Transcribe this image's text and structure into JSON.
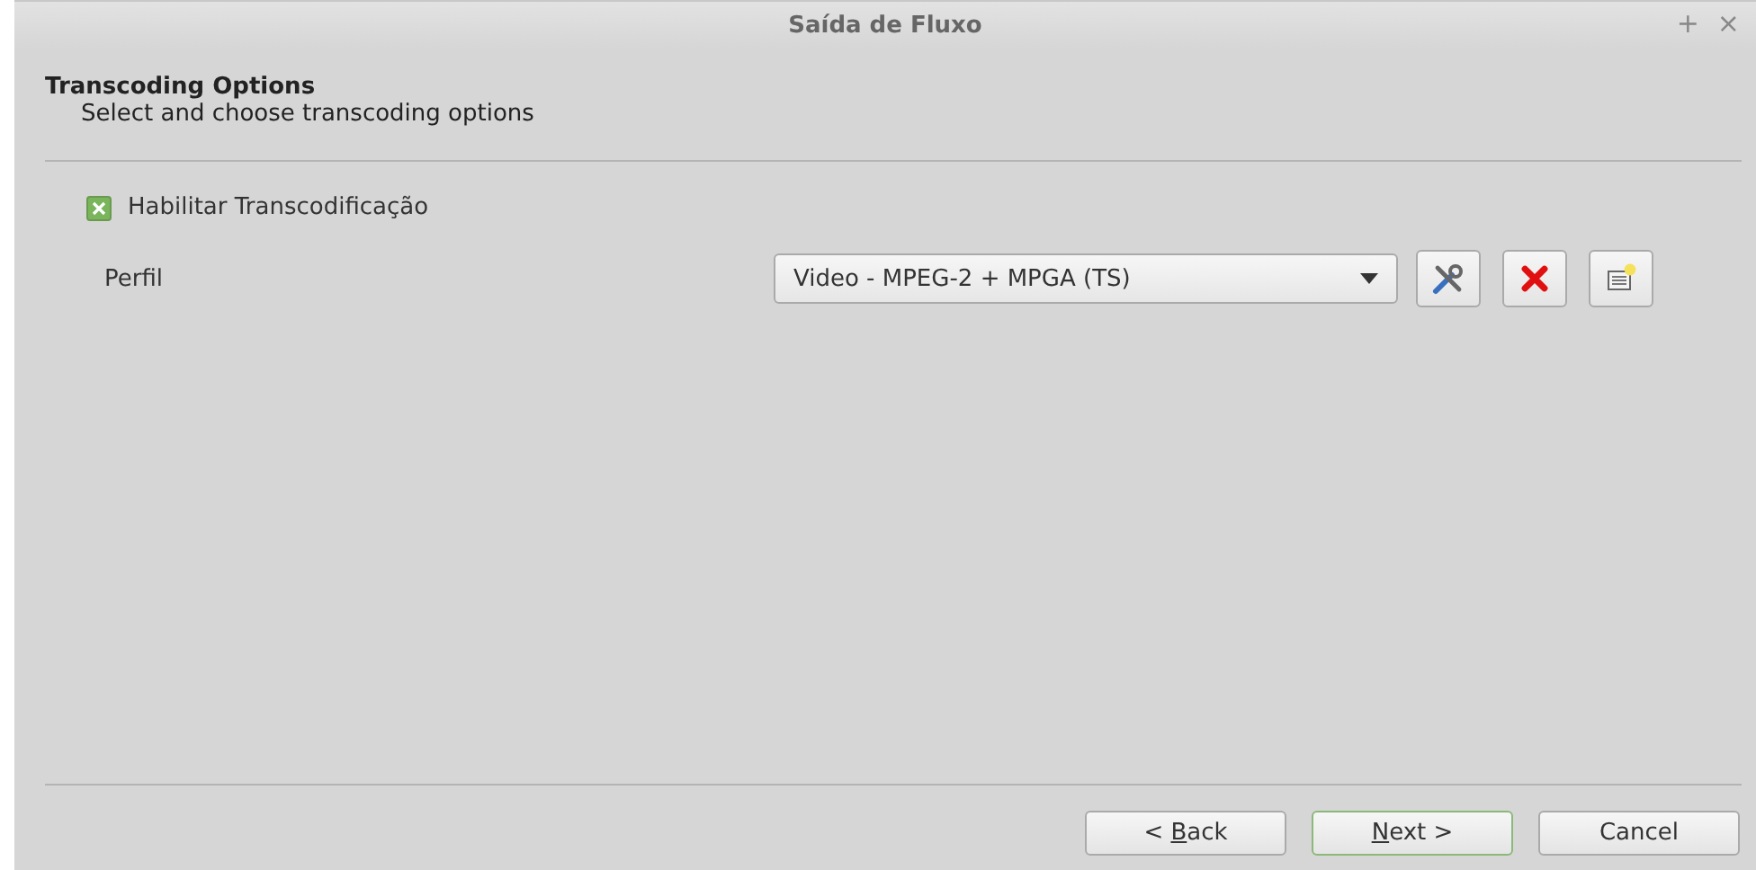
{
  "window": {
    "title": "Saída de Fluxo",
    "controls": [
      "+",
      "×"
    ]
  },
  "header": {
    "title": "Transcoding Options",
    "subtitle": "Select and choose transcoding options"
  },
  "enable_transcoding": {
    "label": "Habilitar Transcodificação",
    "checked": true
  },
  "profile": {
    "label": "Perfil",
    "value": "Video - MPEG-2 + MPGA (TS)"
  },
  "buttons": [
    {
      "before": "< ",
      "mnemonic": "B",
      "after": "ack",
      "default": false
    },
    {
      "mnemonic": "N",
      "after": "ext >",
      "default": true
    },
    {
      "before": "Cancel",
      "default": false
    }
  ]
}
